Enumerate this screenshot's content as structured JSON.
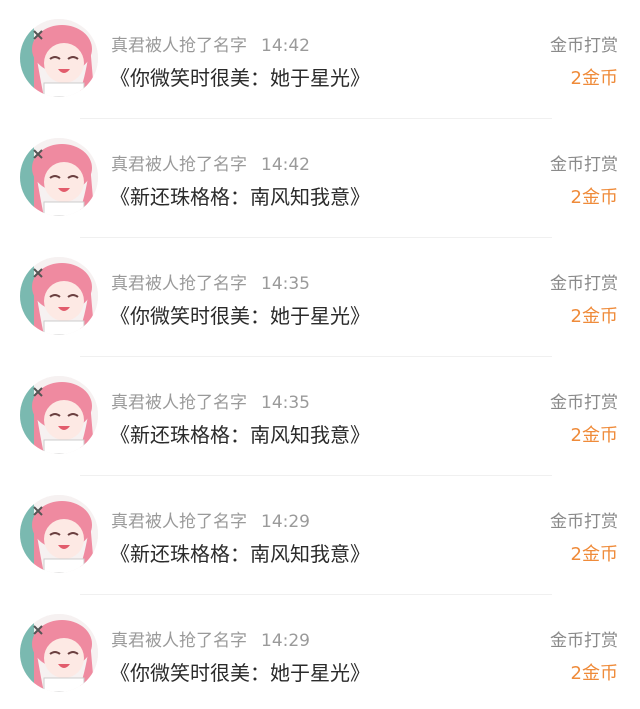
{
  "colors": {
    "meta_text": "#9a9a9a",
    "title_text": "#2b2b2b",
    "amount_text": "#ef8b3a",
    "divider": "#f0f0f0"
  },
  "items": [
    {
      "user": "真君被人抢了名字",
      "time": "14:42",
      "title": "《你微笑时很美：她于星光》",
      "label": "金币打赏",
      "amount": "2金币",
      "avatar_icon": "anime-girl-avatar"
    },
    {
      "user": "真君被人抢了名字",
      "time": "14:42",
      "title": "《新还珠格格：南风知我意》",
      "label": "金币打赏",
      "amount": "2金币",
      "avatar_icon": "anime-girl-avatar"
    },
    {
      "user": "真君被人抢了名字",
      "time": "14:35",
      "title": "《你微笑时很美：她于星光》",
      "label": "金币打赏",
      "amount": "2金币",
      "avatar_icon": "anime-girl-avatar"
    },
    {
      "user": "真君被人抢了名字",
      "time": "14:35",
      "title": "《新还珠格格：南风知我意》",
      "label": "金币打赏",
      "amount": "2金币",
      "avatar_icon": "anime-girl-avatar"
    },
    {
      "user": "真君被人抢了名字",
      "time": "14:29",
      "title": "《新还珠格格：南风知我意》",
      "label": "金币打赏",
      "amount": "2金币",
      "avatar_icon": "anime-girl-avatar"
    },
    {
      "user": "真君被人抢了名字",
      "time": "14:29",
      "title": "《你微笑时很美：她于星光》",
      "label": "金币打赏",
      "amount": "2金币",
      "avatar_icon": "anime-girl-avatar"
    }
  ]
}
